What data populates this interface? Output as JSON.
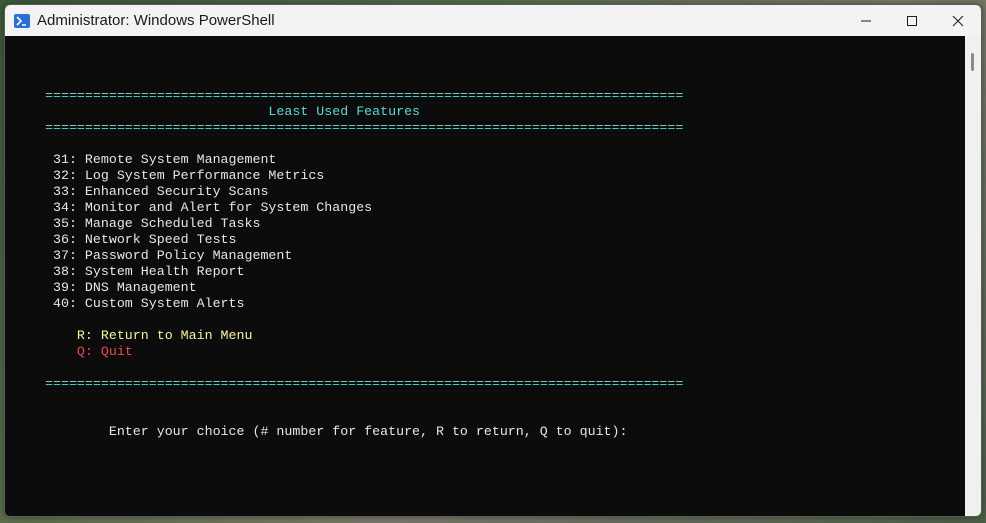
{
  "window": {
    "title": "Administrator: Windows PowerShell"
  },
  "icons": {
    "app": "powershell-icon",
    "minimize": "minimize-icon",
    "maximize": "maximize-icon",
    "close": "close-icon"
  },
  "console": {
    "separator": "================================================================================",
    "header": "                            Least Used Features",
    "menu_items": [
      " 31: Remote System Management",
      " 32: Log System Performance Metrics",
      " 33: Enhanced Security Scans",
      " 34: Monitor and Alert for System Changes",
      " 35: Manage Scheduled Tasks",
      " 36: Network Speed Tests",
      " 37: Password Policy Management",
      " 38: System Health Report",
      " 39: DNS Management",
      " 40: Custom System Alerts"
    ],
    "return_option": "    R: Return to Main Menu",
    "quit_option": "    Q: Quit",
    "prompt": "        Enter your choice (# number for feature, R to return, Q to quit):"
  },
  "colors": {
    "console_bg": "#0c0c0c",
    "cyan": "#61d6d6",
    "white": "#e6e6e6",
    "yellow": "#f9f1a5",
    "red": "#e74856"
  }
}
